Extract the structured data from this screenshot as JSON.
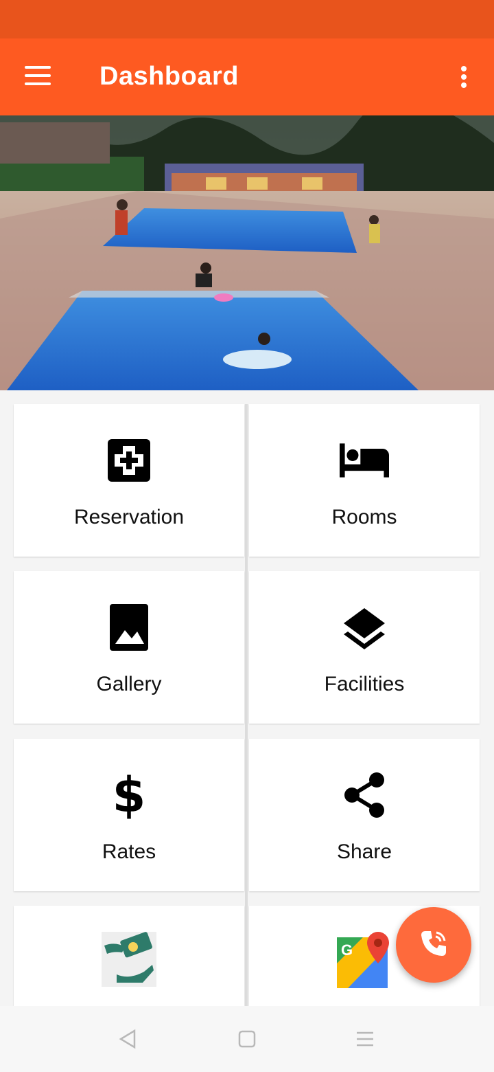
{
  "app": {
    "title": "Dashboard"
  },
  "colors": {
    "status_bar": "#e8541c",
    "app_bar": "#fe5a21",
    "fab": "#fe6a3c"
  },
  "hero": {
    "description_icon": "swimming-pool-photo"
  },
  "tiles": [
    {
      "label": "Reservation",
      "icon": "first-aid-icon"
    },
    {
      "label": "Rooms",
      "icon": "bed-icon"
    },
    {
      "label": "Gallery",
      "icon": "photo-icon"
    },
    {
      "label": "Facilities",
      "icon": "layers-icon"
    },
    {
      "label": "Rates",
      "icon": "dollar-icon"
    },
    {
      "label": "Share",
      "icon": "share-icon"
    },
    {
      "label": "",
      "icon": "money-hand-icon"
    },
    {
      "label": "",
      "icon": "google-maps-icon"
    }
  ],
  "fab": {
    "icon": "phone-icon"
  },
  "navigation": {
    "back_icon": "back-triangle-icon",
    "home_icon": "home-square-icon",
    "recents_icon": "recents-lines-icon"
  }
}
